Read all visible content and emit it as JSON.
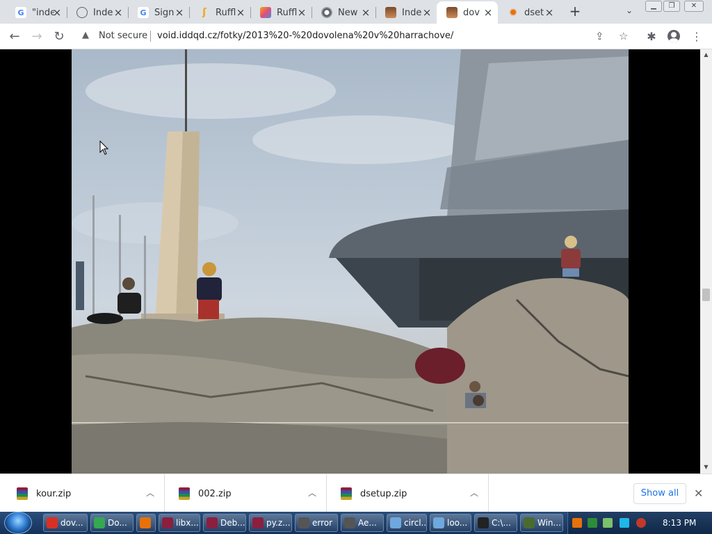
{
  "browser": {
    "tabs": [
      {
        "title": "\"inde",
        "icon": "google-icon",
        "active": false
      },
      {
        "title": "Inde",
        "icon": "globe-icon",
        "active": false
      },
      {
        "title": "Sign",
        "icon": "google-icon",
        "active": false
      },
      {
        "title": "Ruffl",
        "icon": "ruffle-icon",
        "active": false
      },
      {
        "title": "Ruffl",
        "icon": "ruffle-rainbow-icon",
        "active": false
      },
      {
        "title": "New",
        "icon": "chrome-icon",
        "active": false
      },
      {
        "title": "Inde",
        "icon": "face-icon",
        "active": false
      },
      {
        "title": "dov",
        "icon": "face-icon",
        "active": true
      },
      {
        "title": "dset",
        "icon": "gear-orange-icon",
        "active": false
      }
    ],
    "address": {
      "security_label": "Not secure",
      "url": "void.iddqd.cz/fotky/2013%20-%20dovolena%20v%20harrachove/"
    }
  },
  "downloads": {
    "items": [
      {
        "name": "kour.zip"
      },
      {
        "name": "002.zip"
      },
      {
        "name": "dsetup.zip"
      }
    ],
    "show_all_label": "Show all"
  },
  "taskbar": {
    "tasks": [
      {
        "label": "dov...",
        "icon": "chrome-icon",
        "color": "#d93025"
      },
      {
        "label": "Do...",
        "icon": "leaf-icon",
        "color": "#34a853"
      },
      {
        "label": "",
        "icon": "media-player-icon",
        "color": "#e8710a"
      },
      {
        "label": "libx...",
        "icon": "winrar-icon",
        "color": "#8b1f3f"
      },
      {
        "label": "Deb...",
        "icon": "winrar-icon",
        "color": "#8b1f3f"
      },
      {
        "label": "py.z...",
        "icon": "winrar-icon",
        "color": "#8b1f3f"
      },
      {
        "label": "error",
        "icon": "window-icon",
        "color": "#555555"
      },
      {
        "label": "Ae...",
        "icon": "window-icon",
        "color": "#555555"
      },
      {
        "label": "circl...",
        "icon": "notepad-icon",
        "color": "#6fa8dc"
      },
      {
        "label": "loo...",
        "icon": "notepad-icon",
        "color": "#6fa8dc"
      },
      {
        "label": "C:\\...",
        "icon": "cmd-icon",
        "color": "#222222"
      },
      {
        "label": "Win...",
        "icon": "winamp-icon",
        "color": "#4a6b2f"
      }
    ],
    "clock": "8:13 PM"
  }
}
